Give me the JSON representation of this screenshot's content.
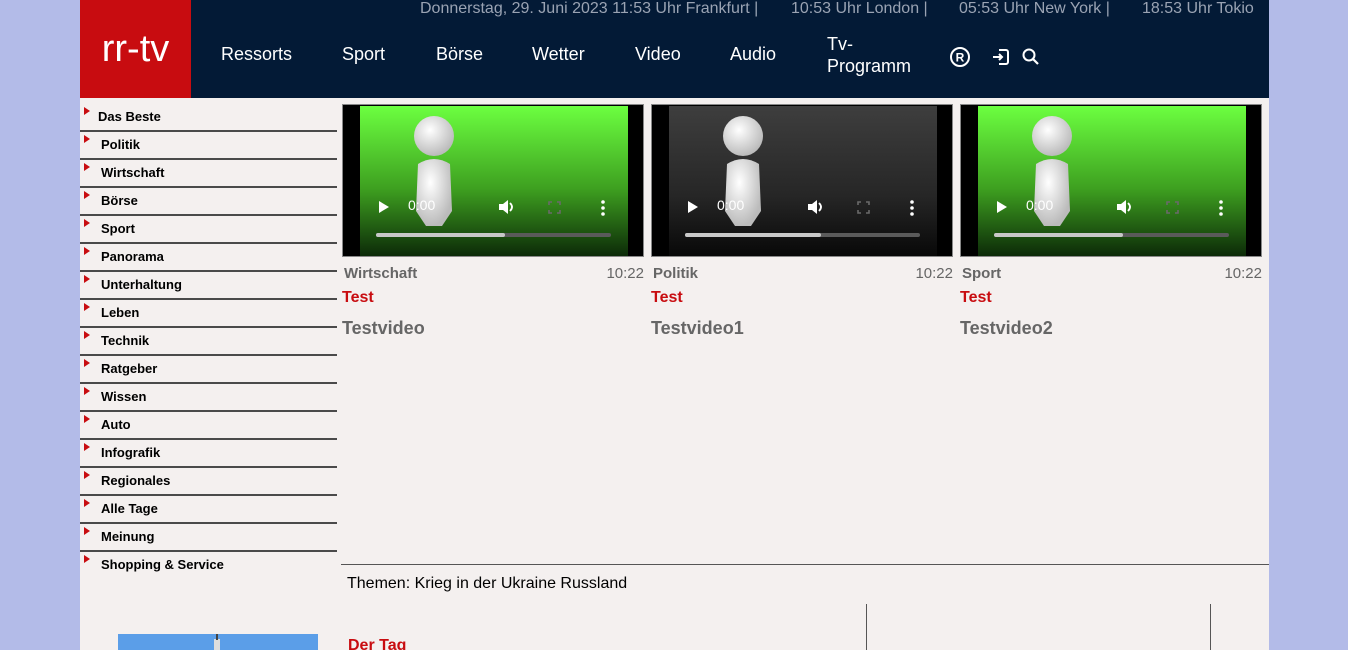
{
  "header": {
    "logo": "rr-tv",
    "datetime": {
      "frankfurt": "Donnerstag, 29. Juni 2023 11:53 Uhr Frankfurt |",
      "london": "10:53 Uhr London |",
      "newyork": "05:53 Uhr New York |",
      "tokio": "18:53 Uhr Tokio"
    },
    "nav": {
      "ressorts": "Ressorts",
      "sport": "Sport",
      "boerse": "Börse",
      "wetter": "Wetter",
      "video": "Video",
      "audio": "Audio",
      "tv_line1": "Tv-",
      "tv_line2": "Programm"
    },
    "icons": [
      "registered-icon",
      "login-icon",
      "search-icon"
    ]
  },
  "sidebar": {
    "items": [
      "Das Beste",
      "Politik",
      "Wirtschaft",
      "Börse",
      "Sport",
      "Panorama",
      "Unterhaltung",
      "Leben",
      "Technik",
      "Ratgeber",
      "Wissen",
      "Auto",
      "Infografik",
      "Regionales",
      "Alle Tage",
      "Meinung",
      "Shopping & Service"
    ]
  },
  "videos": [
    {
      "category": "Wirtschaft",
      "duration": "10:22",
      "kicker": "Test",
      "title": "Testvideo",
      "player_time": "0:00",
      "progress": 0.55,
      "bg": "green"
    },
    {
      "category": "Politik",
      "duration": "10:22",
      "kicker": "Test",
      "title": "Testvideo1",
      "player_time": "0:00",
      "progress": 0.58,
      "bg": "dark"
    },
    {
      "category": "Sport",
      "duration": "10:22",
      "kicker": "Test",
      "title": "Testvideo2",
      "player_time": "0:00",
      "progress": 0.55,
      "bg": "green"
    }
  ],
  "themes": "Themen: Krieg in der Ukraine Russland",
  "section_heading": "Der Tag",
  "colors": {
    "accent": "#c80c10",
    "header_bg": "#031a36",
    "page_bg": "#f4f0ef",
    "outer_bg": "#b3bbe8"
  }
}
